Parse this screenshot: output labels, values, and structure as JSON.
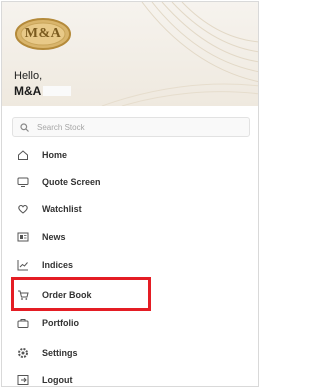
{
  "header": {
    "logo_text": "M&A",
    "greeting": "Hello,",
    "username": "M&A"
  },
  "search": {
    "placeholder": "Search Stock",
    "icon": "search-icon"
  },
  "menu": {
    "items": [
      {
        "label": "Home",
        "icon": "home-icon"
      },
      {
        "label": "Quote Screen",
        "icon": "monitor-icon"
      },
      {
        "label": "Watchlist",
        "icon": "heart-icon"
      },
      {
        "label": "News",
        "icon": "news-icon"
      },
      {
        "label": "Indices",
        "icon": "chart-icon"
      },
      {
        "label": "Order Book",
        "icon": "cart-icon"
      },
      {
        "label": "Portfolio",
        "icon": "briefcase-icon"
      },
      {
        "label": "Settings",
        "icon": "gear-icon"
      },
      {
        "label": "Logout",
        "icon": "logout-icon"
      }
    ]
  },
  "colors": {
    "highlight": "#e41d24",
    "logo_gold": "#c9a55a",
    "header_bg": "#f2ede5"
  }
}
